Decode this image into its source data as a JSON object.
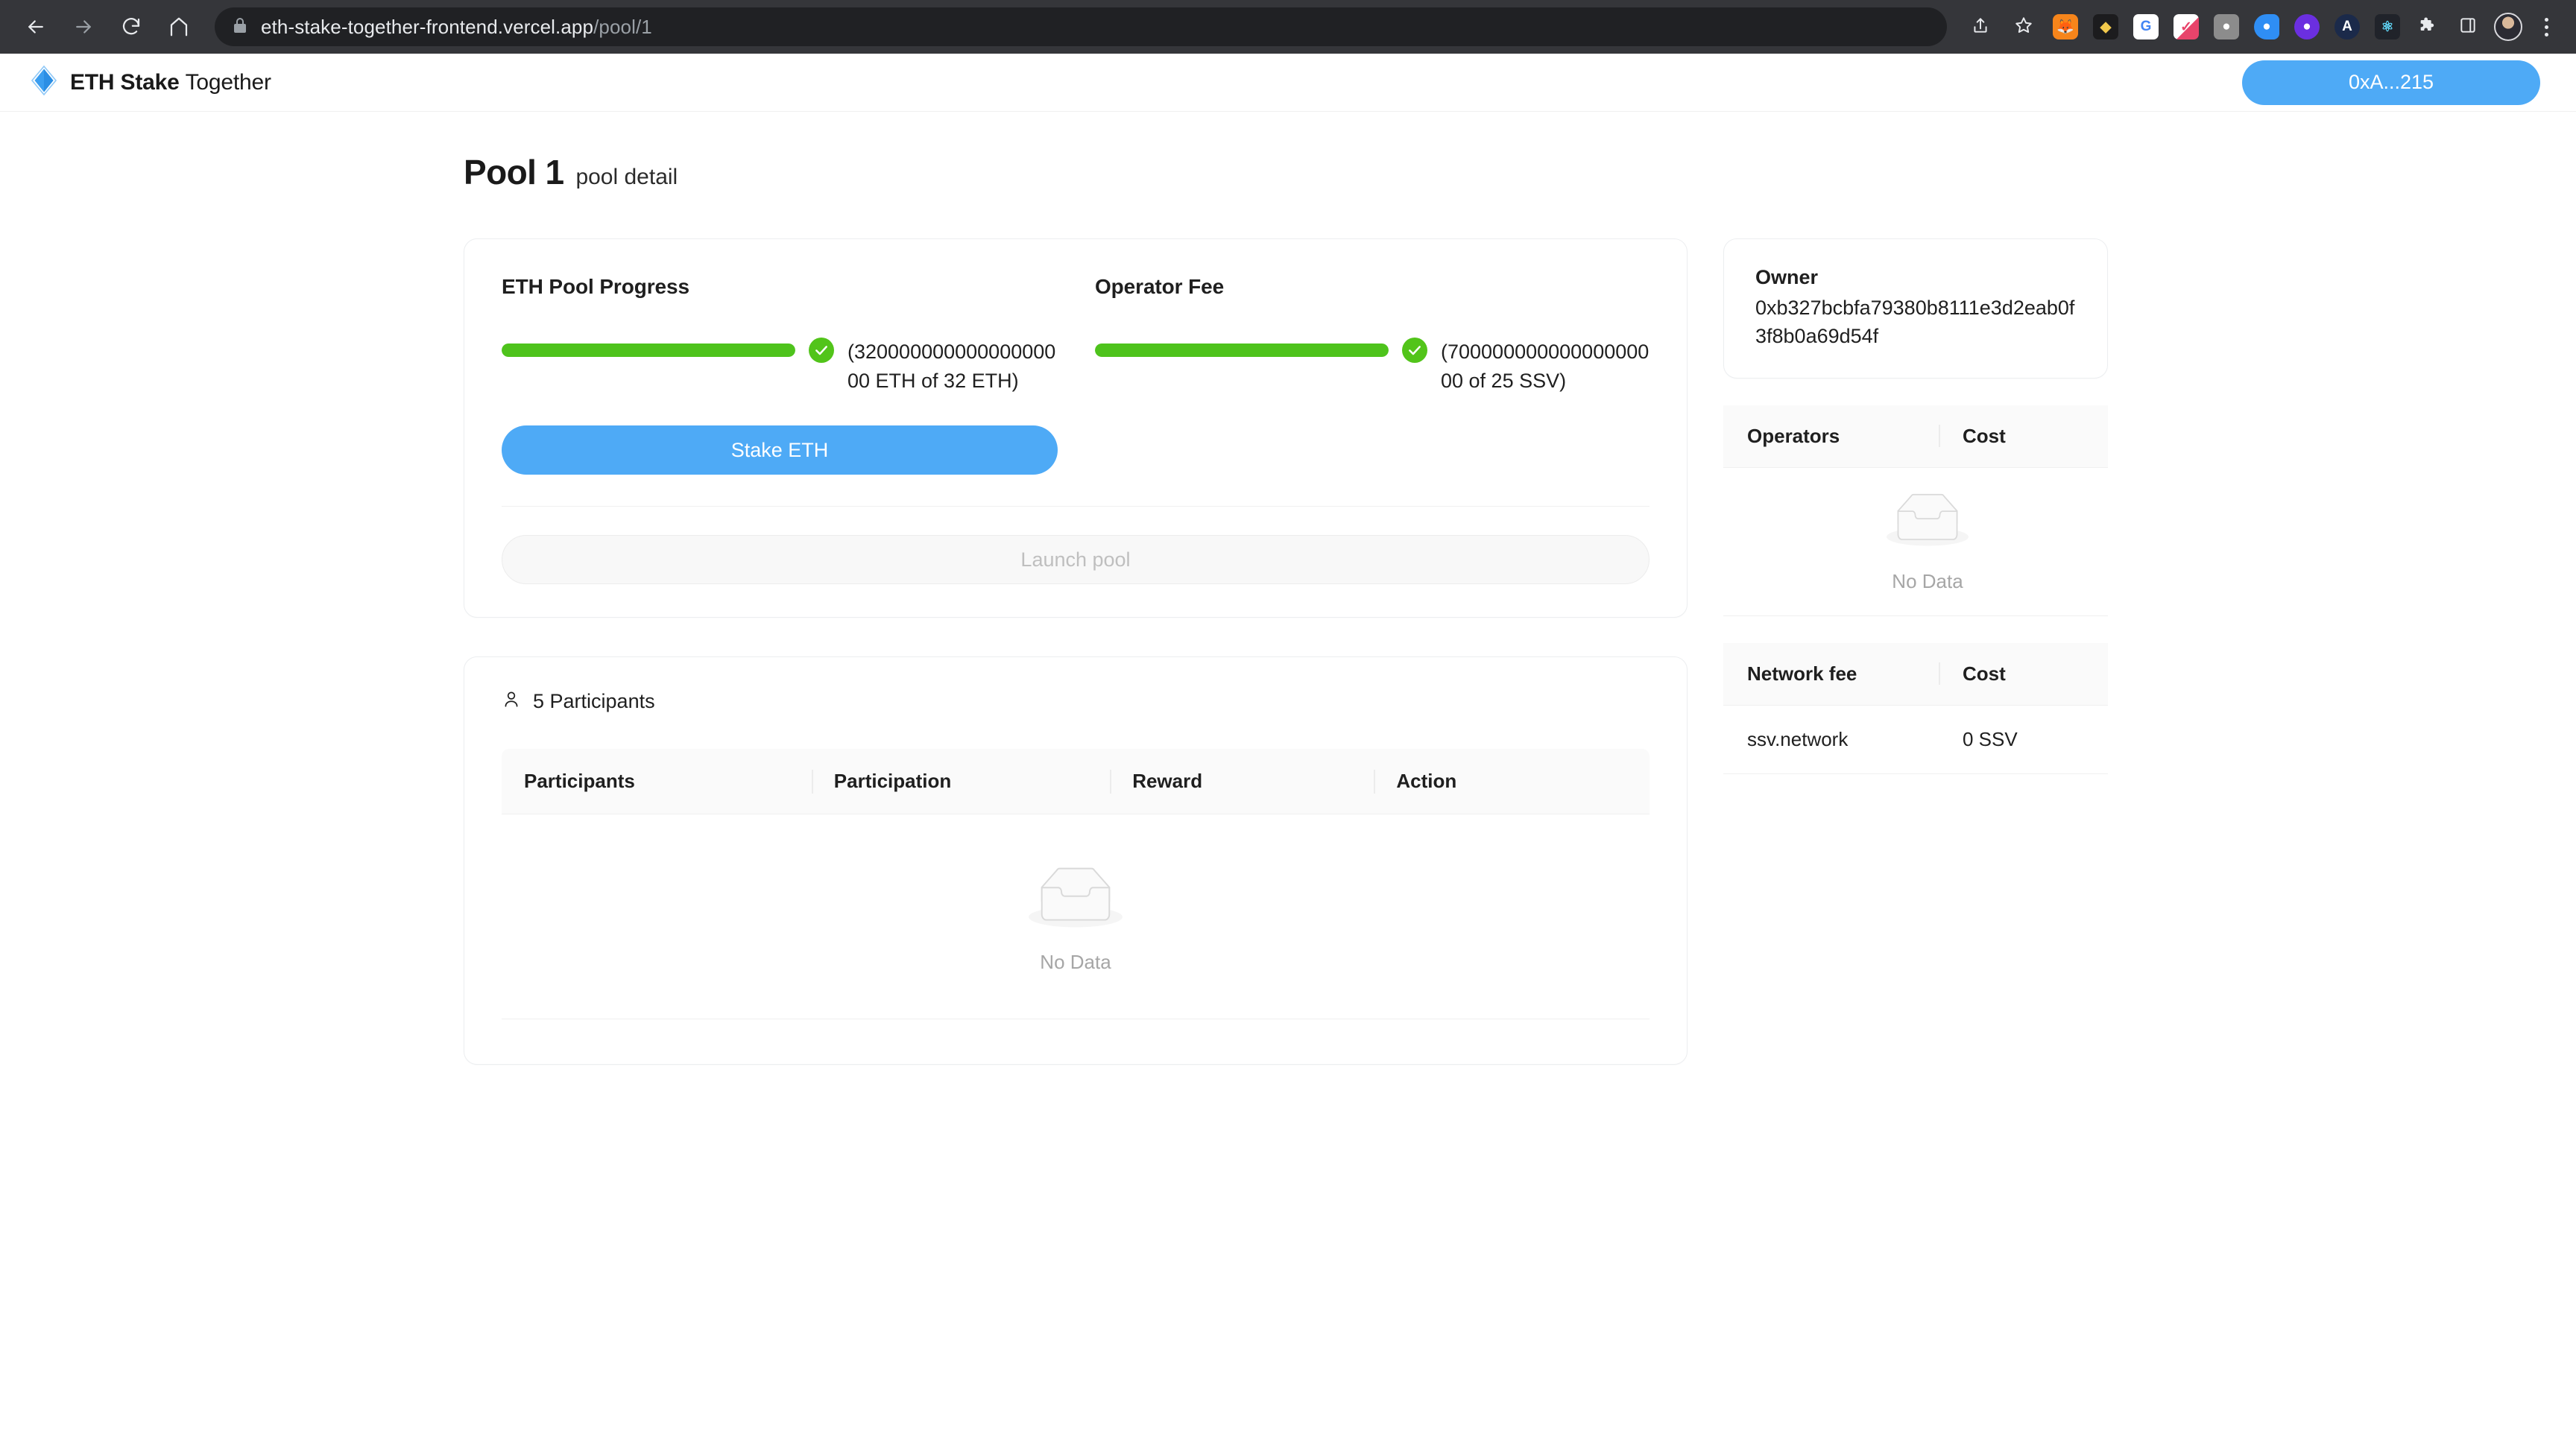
{
  "browser": {
    "back_icon": "back-arrow-icon",
    "forward_icon": "forward-arrow-icon",
    "reload_icon": "reload-icon",
    "home_icon": "home-icon",
    "lock_icon": "lock-icon",
    "url_domain": "eth-stake-together-frontend.vercel.app",
    "url_path": "/pool/1",
    "share_icon": "share-icon",
    "bookmark_icon": "star-icon",
    "extensions": [
      {
        "name": "metamask-extension-icon",
        "glyph": "🦊",
        "bg": "#f6851b"
      },
      {
        "name": "rabby-wallet-extension-icon",
        "glyph": "🐺",
        "bg": "#1c1c1e"
      },
      {
        "name": "google-translate-extension-icon",
        "glyph": "G",
        "bg": "#ffffff"
      },
      {
        "name": "eyedropper-extension-icon",
        "glyph": "✐",
        "bg": "#ffffff"
      },
      {
        "name": "camera-extension-icon",
        "glyph": "●",
        "bg": "#8c8c8c"
      },
      {
        "name": "tag-extension-icon",
        "glyph": "◆",
        "bg": "#2f8ef4"
      },
      {
        "name": "chat-extension-icon",
        "glyph": "●",
        "bg": "#6b2fe0"
      },
      {
        "name": "axiom-extension-icon",
        "glyph": "A",
        "bg": "#1b2a4a"
      },
      {
        "name": "react-devtools-extension-icon",
        "glyph": "⚛",
        "bg": "#20232a"
      },
      {
        "name": "extensions-puzzle-icon",
        "glyph": "❖",
        "bg": "transparent"
      },
      {
        "name": "sidebar-toggle-icon",
        "glyph": "⬜",
        "bg": "transparent"
      }
    ],
    "profile_icon": "profile-avatar-icon",
    "menu_icon": "kebab-menu-icon"
  },
  "app_header": {
    "logo_icon": "eth-diamond-logo-icon",
    "brand_bold": "ETH Stake",
    "brand_light": "Together",
    "wallet_label": "0xA...215",
    "accent_color": "#4eaaf6"
  },
  "page": {
    "title": "Pool 1",
    "subtitle": "pool detail"
  },
  "pool_progress": {
    "heading": "ETH Pool Progress",
    "amount_text": "(32000000000000000000 ETH of 32 ETH)",
    "percent": 100,
    "status_icon": "check-circle-icon",
    "bar_color": "#4ec31c"
  },
  "operator_fee": {
    "heading": "Operator Fee",
    "amount_text": "(70000000000000000000 of 25 SSV)",
    "percent": 100,
    "status_icon": "check-circle-icon",
    "bar_color": "#4ec31c"
  },
  "actions": {
    "stake_label": "Stake ETH",
    "launch_label": "Launch pool"
  },
  "participants": {
    "icon": "user-icon",
    "count_label": "5 Participants",
    "columns": [
      "Participants",
      "Participation",
      "Reward",
      "Action"
    ],
    "rows": [],
    "empty_icon": "empty-inbox-icon",
    "empty_text": "No Data"
  },
  "sidebar": {
    "owner": {
      "label": "Owner",
      "address": "0xb327bcbfa79380b8111e3d2eab0f3f8b0a69d54f"
    },
    "operators": {
      "columns": [
        "Operators",
        "Cost"
      ],
      "rows": [],
      "empty_icon": "empty-inbox-icon",
      "empty_text": "No Data"
    },
    "network_fee": {
      "columns": [
        "Network fee",
        "Cost"
      ],
      "rows": [
        {
          "name": "ssv.network",
          "cost": "0 SSV"
        }
      ]
    }
  }
}
